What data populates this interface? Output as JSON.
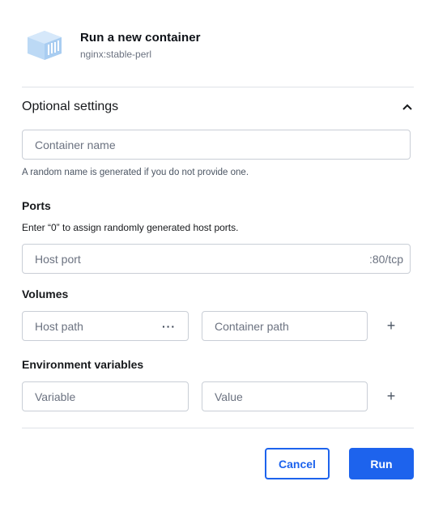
{
  "header": {
    "logo_icon": "container-box-icon",
    "title": "Run a new container",
    "image_name": "nginx:stable-perl"
  },
  "optional_settings": {
    "label": "Optional settings",
    "toggle_icon": "chevron-up-icon",
    "expanded": true
  },
  "container_name": {
    "placeholder": "Container name",
    "hint": "A random name is generated if you do not provide one."
  },
  "ports": {
    "heading": "Ports",
    "help": "Enter “0” to assign randomly generated host ports.",
    "host_port_placeholder": "Host port",
    "container_port": ":80/tcp"
  },
  "volumes": {
    "heading": "Volumes",
    "host_path_placeholder": "Host path",
    "browse_label": "···",
    "container_path_placeholder": "Container path",
    "add_label": "+"
  },
  "env": {
    "heading": "Environment variables",
    "variable_placeholder": "Variable",
    "value_placeholder": "Value",
    "add_label": "+"
  },
  "actions": {
    "cancel_label": "Cancel",
    "run_label": "Run"
  },
  "colors": {
    "accent": "#1d63ed",
    "logo_fill": "#bcd9f5"
  }
}
